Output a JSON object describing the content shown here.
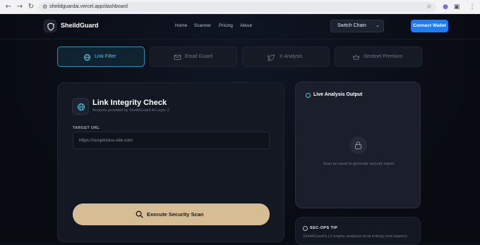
{
  "browser": {
    "url": "sheildguardai.vercel.app/dashboard",
    "back_icon": "arrow-left-icon",
    "forward_icon": "arrow-right-icon",
    "reload_icon": "reload-icon"
  },
  "header": {
    "brand": "SheildGuard",
    "nav": [
      "Home",
      "Scanner",
      "Pricing",
      "About"
    ],
    "chain_select": "Switch Chain",
    "connect_label": "Connect Wallet"
  },
  "tabs": [
    {
      "label": "Link Filter",
      "icon": "globe-icon",
      "active": true
    },
    {
      "label": "Email Guard",
      "icon": "mail-icon",
      "active": false
    },
    {
      "label": "X Analysis",
      "icon": "twitter-icon",
      "active": false
    },
    {
      "label": "Sentinel Premium",
      "icon": "crown-icon",
      "active": false
    }
  ],
  "scanner": {
    "title": "Link Integrity Check",
    "subtitle": "Analysis provided by SheildGuard AI Layer 2",
    "field_label": "TARGET URL",
    "placeholder": "https://suspicious-site.com",
    "button_label": "Execute Security Scan"
  },
  "output": {
    "title": "Live Analysis Output",
    "empty_text": "Scan an asset to generate security report"
  },
  "tip": {
    "title": "SEC-OPS TIP",
    "text": "SheildGuard's L2 engine analyzes local entropy and urgency"
  },
  "colors": {
    "accent": "#4fc7e8",
    "primary_button": "#1f7cf2",
    "scan_button": "#d7bd94"
  }
}
